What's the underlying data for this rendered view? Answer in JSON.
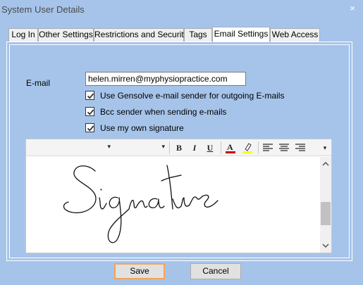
{
  "window": {
    "title": "System User Details",
    "close_glyph": "×"
  },
  "tabs": [
    {
      "label": "Log In"
    },
    {
      "label": "Other Settings"
    },
    {
      "label": "Restrictions and Security"
    },
    {
      "label": "Tags"
    },
    {
      "label": "Email Settings",
      "active": true
    },
    {
      "label": "Web Access"
    }
  ],
  "email": {
    "label": "E-mail",
    "value": "helen.mirren@myphysiopractice.com"
  },
  "checkboxes": [
    {
      "label": "Use Gensolve e-mail sender for outgoing E-mails",
      "checked": true
    },
    {
      "label": "Bcc sender when sending e-mails",
      "checked": true
    },
    {
      "label": "Use my  own signature",
      "checked": true
    }
  ],
  "toolbar": {
    "bold": "B",
    "italic": "I",
    "underline": "U",
    "icons": [
      "font-color-icon",
      "highlight-icon",
      "align-left-icon",
      "align-center-icon",
      "align-right-icon"
    ],
    "font_color": "#cc0000",
    "highlight_color": "#ffff00"
  },
  "buttons": {
    "save": "Save",
    "cancel": "Cancel"
  },
  "colors": {
    "background": "#a6c4ea",
    "default_button_border": "#f3a35b"
  }
}
